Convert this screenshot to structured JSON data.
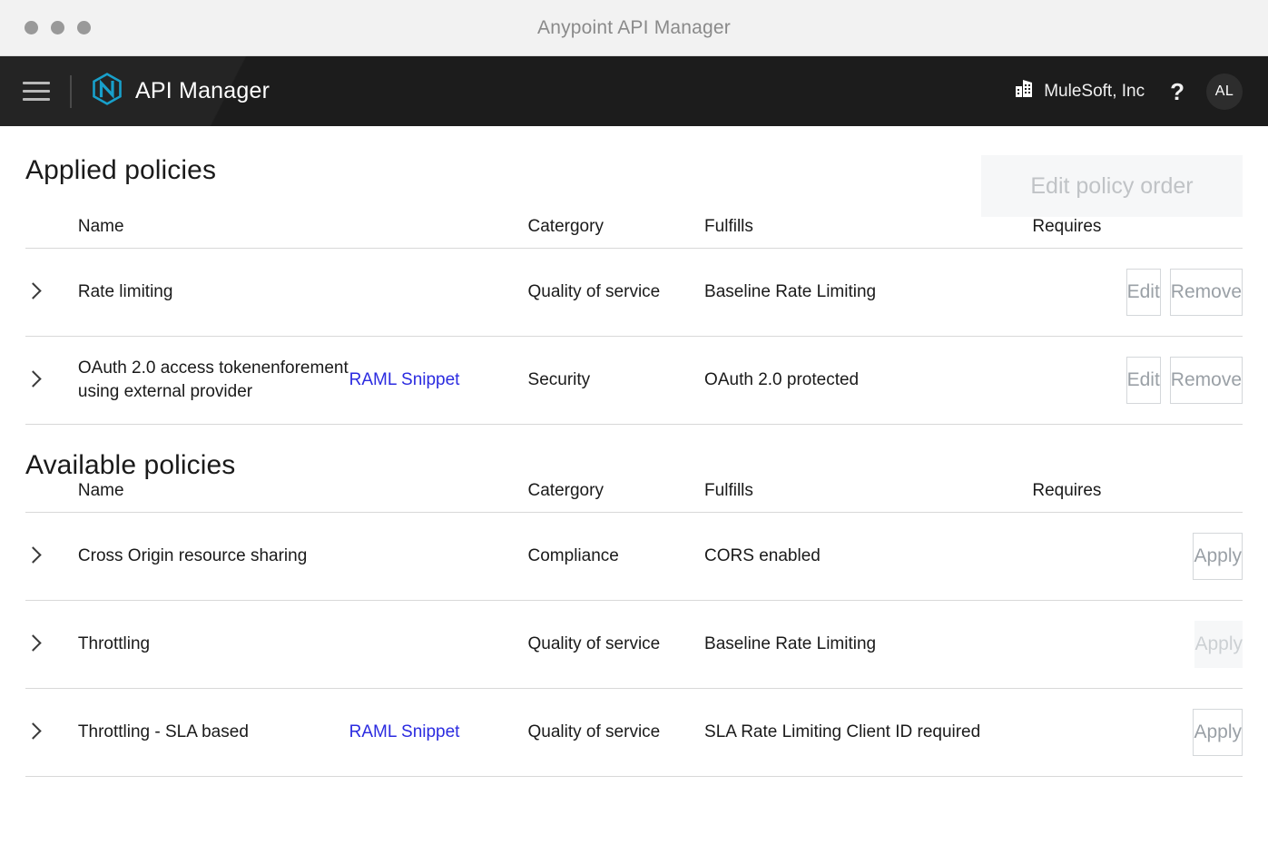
{
  "window": {
    "title": "Anypoint API Manager"
  },
  "header": {
    "menu_icon": "hamburger-icon",
    "logo_icon": "anypoint-logo-icon",
    "app_title": "API Manager",
    "org_icon": "building-icon",
    "org_name": "MuleSoft, Inc",
    "help_label": "?",
    "avatar_initials": "AL",
    "background_color": "#1c1c1c",
    "logo_color": "#18a0cb"
  },
  "applied": {
    "section_title": "Applied policies",
    "edit_order_label": "Edit policy order",
    "edit_order_disabled": true,
    "columns": {
      "name": "Name",
      "category": "Catergory",
      "fulfills": "Fulfills",
      "requires": "Requires"
    },
    "rows": [
      {
        "name": "Rate limiting",
        "snippet": "",
        "category": "Quality of service",
        "fulfills": "Baseline Rate Limiting",
        "requires": "",
        "edit_label": "Edit",
        "remove_label": "Remove"
      },
      {
        "name": "OAuth 2.0 access tokenenforement using external provider",
        "snippet": "RAML Snippet",
        "category": "Security",
        "fulfills": "OAuth 2.0 protected",
        "requires": "",
        "edit_label": "Edit",
        "remove_label": "Remove"
      }
    ]
  },
  "available": {
    "section_title": "Available policies",
    "columns": {
      "name": "Name",
      "category": "Catergory",
      "fulfills": "Fulfills",
      "requires": "Requires"
    },
    "rows": [
      {
        "name": "Cross Origin resource sharing",
        "snippet": "",
        "category": "Compliance",
        "fulfills": "CORS enabled",
        "requires": "",
        "apply_label": "Apply",
        "apply_disabled": false
      },
      {
        "name": "Throttling",
        "snippet": "",
        "category": "Quality of service",
        "fulfills": "Baseline Rate Limiting",
        "requires": "",
        "apply_label": "Apply",
        "apply_disabled": true
      },
      {
        "name": "Throttling - SLA based",
        "snippet": "RAML Snippet",
        "category": "Quality of service",
        "fulfills": "SLA Rate Limiting Client ID required",
        "requires": "",
        "apply_label": "Apply",
        "apply_disabled": false
      }
    ]
  },
  "colors": {
    "link": "#2b2be0",
    "text": "#1a1a1a",
    "muted": "#9aa0a6",
    "divider": "#d8d8d8"
  }
}
